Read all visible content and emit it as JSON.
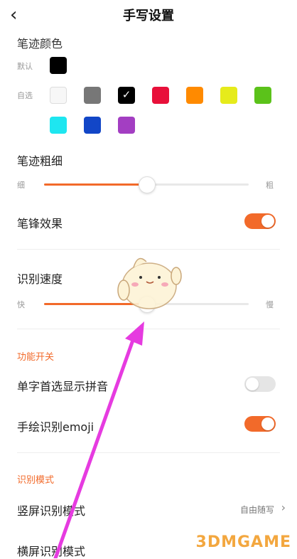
{
  "header": {
    "title": "手写设置",
    "back_icon": "chevron-left-icon"
  },
  "stroke_color": {
    "title": "笔迹颜色",
    "default_label": "默认",
    "custom_label": "自选",
    "default_color": "#000000",
    "custom_colors": [
      "#f7f7f7",
      "#777777",
      "#000000",
      "#e8103a",
      "#ff8a00",
      "#e6eb1b",
      "#5bc21a",
      "#1ee6f0",
      "#1246c7",
      "#a33ec2"
    ],
    "selected_index": 2
  },
  "stroke_width": {
    "title": "笔迹粗细",
    "min_label": "细",
    "max_label": "粗",
    "value_fraction": 0.5
  },
  "pen_tip": {
    "label": "笔锋效果",
    "enabled": true
  },
  "recognition_speed": {
    "title": "识别速度",
    "min_label": "快",
    "max_label": "慢",
    "value_fraction": 0.5
  },
  "features": {
    "title": "功能开关",
    "items": [
      {
        "label": "单字首选显示拼音",
        "enabled": false
      },
      {
        "label": "手绘识别emoji",
        "enabled": true
      }
    ]
  },
  "mode": {
    "title": "识别模式",
    "items": [
      {
        "label": "竖屏识别模式",
        "value": "自由随写"
      },
      {
        "label": "横屏识别模式",
        "value": ""
      }
    ]
  },
  "watermark": {
    "text": "3DMGAME"
  },
  "colors": {
    "accent": "#f26a2a",
    "annotation_arrow": "#e63be0"
  }
}
